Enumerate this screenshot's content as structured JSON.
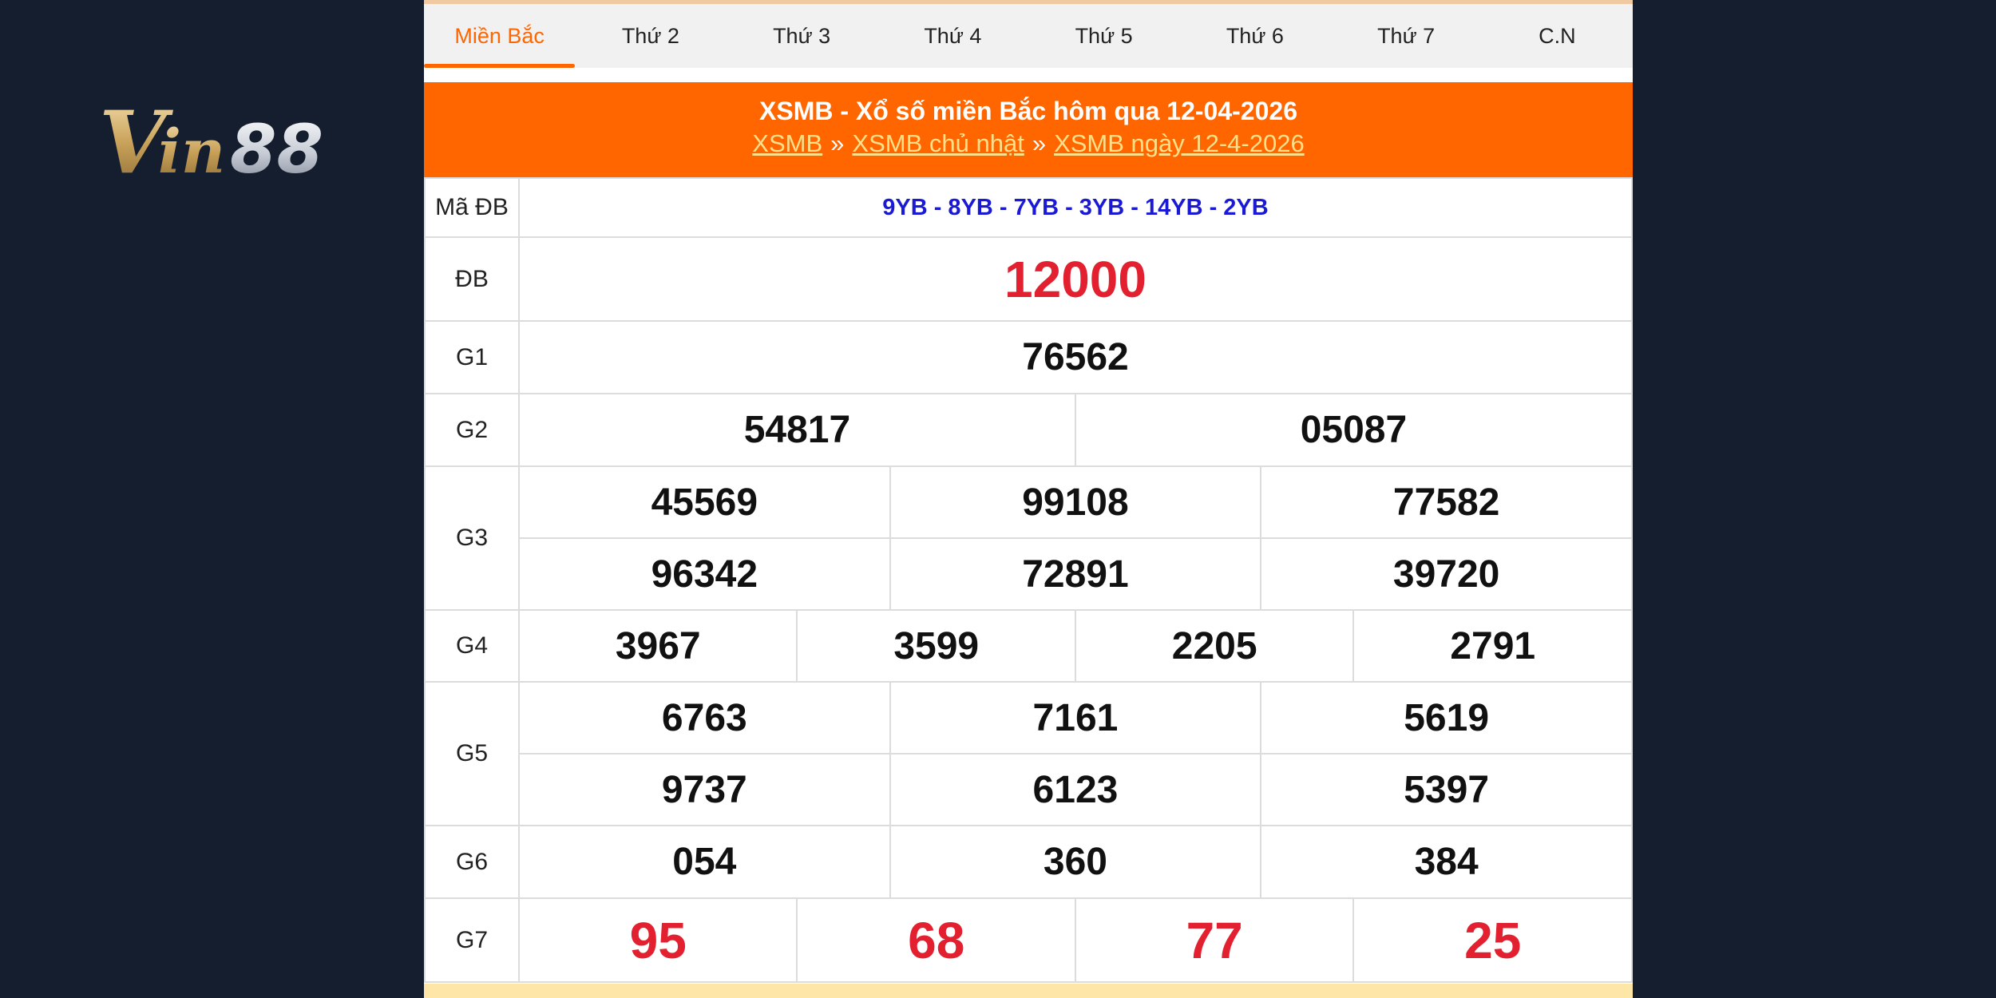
{
  "brand": {
    "logo_text": "Vin88"
  },
  "tabs": [
    {
      "label": "Miền Bắc",
      "active": true
    },
    {
      "label": "Thứ 2"
    },
    {
      "label": "Thứ 3"
    },
    {
      "label": "Thứ 4"
    },
    {
      "label": "Thứ 5"
    },
    {
      "label": "Thứ 6"
    },
    {
      "label": "Thứ 7"
    },
    {
      "label": "C.N"
    }
  ],
  "header": {
    "title": "XSMB - Xổ số miền Bắc hôm qua 12-04-2026",
    "breadcrumb": [
      "XSMB",
      "XSMB chủ nhật",
      "XSMB ngày 12-4-2026"
    ],
    "separator": "»"
  },
  "results": {
    "ma_db": {
      "label": "Mã ĐB",
      "value": "9YB - 8YB - 7YB - 3YB - 14YB - 2YB"
    },
    "db": {
      "label": "ĐB",
      "value": "12000"
    },
    "g1": {
      "label": "G1",
      "values": [
        "76562"
      ]
    },
    "g2": {
      "label": "G2",
      "values": [
        "54817",
        "05087"
      ]
    },
    "g3": {
      "label": "G3",
      "values": [
        "45569",
        "99108",
        "77582",
        "96342",
        "72891",
        "39720"
      ]
    },
    "g4": {
      "label": "G4",
      "values": [
        "3967",
        "3599",
        "2205",
        "2791"
      ]
    },
    "g5": {
      "label": "G5",
      "values": [
        "6763",
        "7161",
        "5619",
        "9737",
        "6123",
        "5397"
      ]
    },
    "g6": {
      "label": "G6",
      "values": [
        "054",
        "360",
        "384"
      ]
    },
    "g7": {
      "label": "G7",
      "values": [
        "95",
        "68",
        "77",
        "25"
      ]
    }
  },
  "colors": {
    "accent": "#ff6600",
    "highlight": "#e3202f",
    "code": "#1a1ad6",
    "background": "#141e2e"
  }
}
